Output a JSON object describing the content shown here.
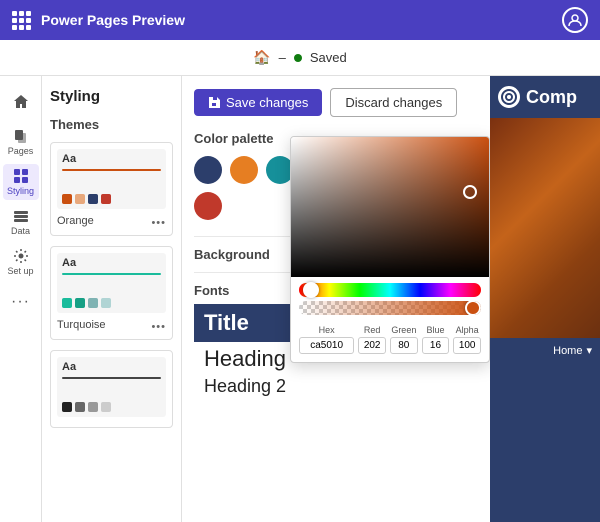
{
  "topbar": {
    "title": "Power Pages Preview",
    "grid_icon": "grid-icon",
    "user_icon": "user-icon"
  },
  "secondbar": {
    "home_label": "🏠",
    "separator": "–",
    "status": "Saved"
  },
  "sidebar": {
    "items": [
      {
        "id": "home",
        "label": "Home",
        "icon": "home-icon"
      },
      {
        "id": "pages",
        "label": "Pages",
        "icon": "pages-icon"
      },
      {
        "id": "styling",
        "label": "Styling",
        "icon": "styling-icon",
        "active": true
      },
      {
        "id": "data",
        "label": "Data",
        "icon": "data-icon"
      },
      {
        "id": "setup",
        "label": "Set up",
        "icon": "setup-icon"
      },
      {
        "id": "more",
        "label": "...",
        "icon": "more-icon"
      }
    ]
  },
  "themes_panel": {
    "heading": "Styling",
    "themes_label": "Themes",
    "themes": [
      {
        "id": "orange",
        "name": "Orange",
        "aa_color": "#333",
        "line_color": "#ca5010",
        "swatches": [
          "#ca5010",
          "#e8a87c",
          "#2c3e6b",
          "#c0392b",
          "#e67e22"
        ]
      },
      {
        "id": "turquoise",
        "name": "Turquoise",
        "aa_color": "#333",
        "line_color": "#1abc9c",
        "swatches": [
          "#1abc9c",
          "#16a085",
          "#2c3e6b",
          "#7fb3b3",
          "#b0d4d4"
        ]
      },
      {
        "id": "third",
        "name": "",
        "aa_color": "#333",
        "line_color": "#444",
        "swatches": [
          "#222",
          "#666",
          "#999",
          "#ccc",
          "#eee"
        ]
      }
    ]
  },
  "toolbar": {
    "save_icon": "save-icon",
    "save_label": "Save changes",
    "discard_label": "Discard changes"
  },
  "styling_content": {
    "color_palette_label": "Color palette",
    "colors": [
      {
        "hex": "#2c3e6b",
        "label": "dark-blue"
      },
      {
        "hex": "#e67e22",
        "label": "orange"
      },
      {
        "hex": "#16909a",
        "label": "teal"
      },
      {
        "hex": "#ca5010",
        "label": "red-orange",
        "selected": true
      },
      {
        "hex": "#f5e6c8",
        "label": "cream"
      },
      {
        "hex": "#7aa09a",
        "label": "sage"
      },
      {
        "hex": "#ffffff",
        "label": "white"
      },
      {
        "hex": "#555555",
        "label": "dark-gray"
      },
      {
        "hex": "#c0392b",
        "label": "red"
      }
    ],
    "background_label": "Background",
    "fonts_label": "Fonts",
    "font_title": "Title",
    "font_heading1": "Heading",
    "font_heading2": "Heading 2"
  },
  "color_picker": {
    "hex_label": "Hex",
    "red_label": "Red",
    "green_label": "Green",
    "blue_label": "Blue",
    "alpha_label": "Alpha",
    "hex_value": "ca5010",
    "red_value": "202",
    "green_value": "80",
    "blue_value": "16",
    "alpha_value": "100"
  },
  "preview": {
    "logo_text": "Comp",
    "brand_color": "#2c3e6b"
  },
  "nav": {
    "home_label": "Home",
    "chevron": "▾"
  }
}
